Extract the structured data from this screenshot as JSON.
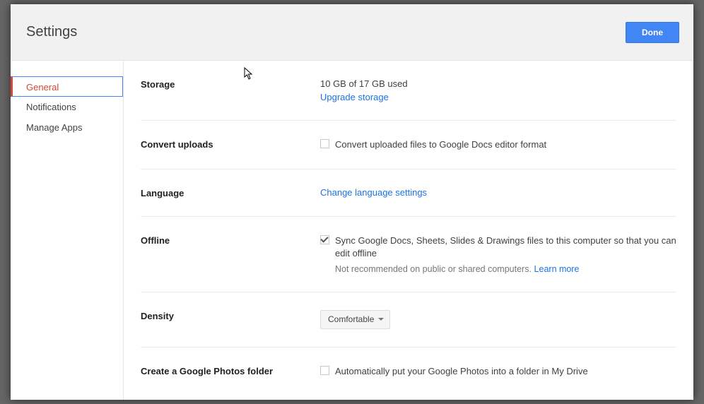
{
  "header": {
    "title": "Settings",
    "done_label": "Done"
  },
  "sidebar": {
    "items": [
      {
        "label": "General",
        "active": true
      },
      {
        "label": "Notifications",
        "active": false
      },
      {
        "label": "Manage Apps",
        "active": false
      }
    ]
  },
  "sections": {
    "storage": {
      "label": "Storage",
      "usage": "10 GB of 17 GB used",
      "upgrade_link": "Upgrade storage"
    },
    "convert": {
      "label": "Convert uploads",
      "checkbox_label": "Convert uploaded files to Google Docs editor format",
      "checked": false
    },
    "language": {
      "label": "Language",
      "link": "Change language settings"
    },
    "offline": {
      "label": "Offline",
      "checkbox_label": "Sync Google Docs, Sheets, Slides & Drawings files to this computer so that you can edit offline",
      "checked": true,
      "note": "Not recommended on public or shared computers.",
      "learn_more": "Learn more"
    },
    "density": {
      "label": "Density",
      "value": "Comfortable"
    },
    "photos": {
      "label": "Create a Google Photos folder",
      "checkbox_label": "Automatically put your Google Photos into a folder in My Drive",
      "checked": false
    }
  }
}
